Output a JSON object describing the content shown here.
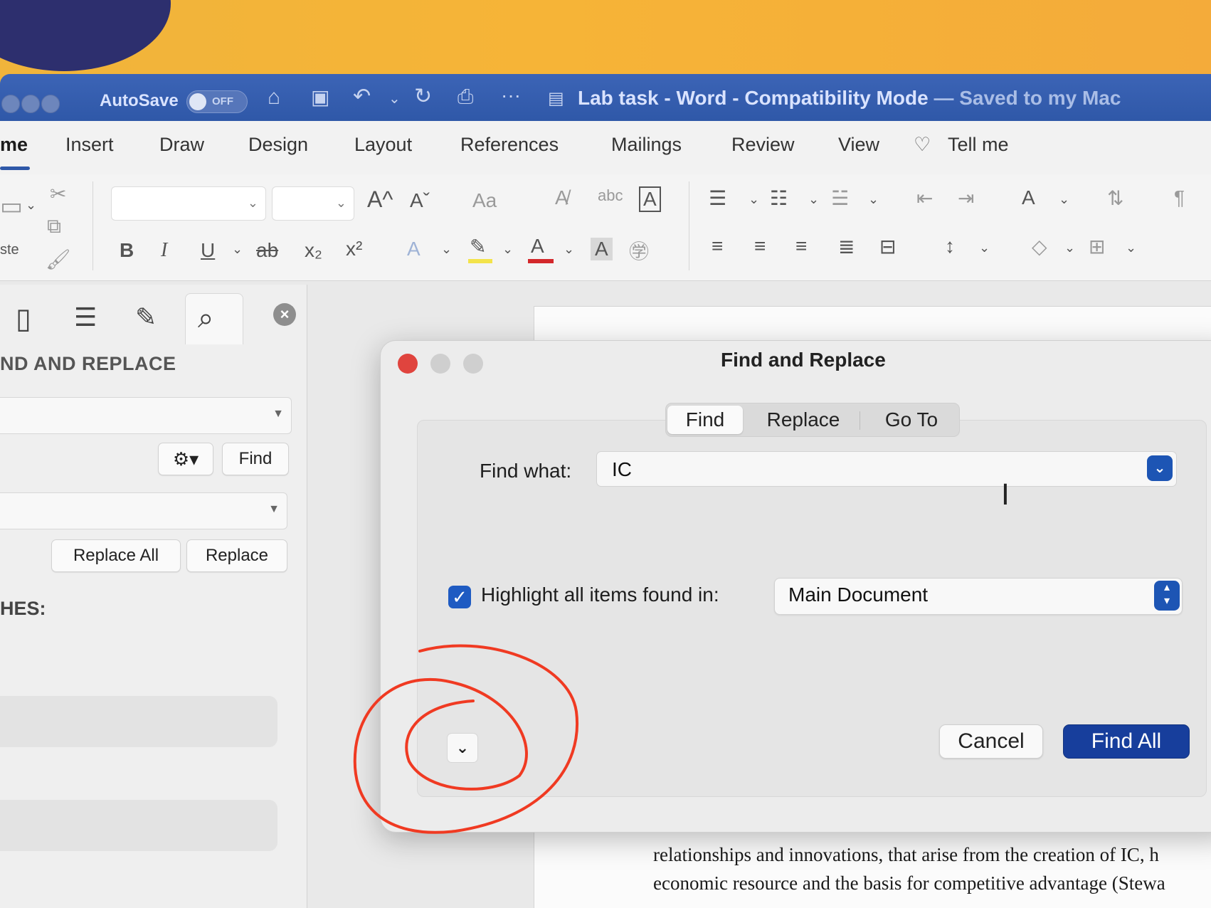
{
  "titlebar": {
    "autosave_label": "AutoSave",
    "autosave_state": "OFF",
    "doc_name": "Lab task",
    "app_name": "Word",
    "mode": "Compatibility Mode",
    "save_status": "— Saved to my Mac"
  },
  "ribbon_tabs": [
    "me",
    "Insert",
    "Draw",
    "Design",
    "Layout",
    "References",
    "Mailings",
    "Review",
    "View",
    "Tell me"
  ],
  "ribbon": {
    "paste_label": "ste",
    "bold": "B",
    "italic": "I",
    "underline": "U",
    "strikethrough": "ab",
    "subscript": "x₂",
    "superscript": "x²",
    "grow_font": "A^",
    "shrink_font": "Aˇ",
    "change_case": "Aa",
    "font_color": "A",
    "char_shading": "A",
    "pilcrow": "¶"
  },
  "nav_pane": {
    "heading": "ND AND REPLACE",
    "find_button": "Find",
    "replace_all_button": "Replace All",
    "replace_button": "Replace",
    "matches_heading": "HES:"
  },
  "dialog": {
    "title": "Find and Replace",
    "tabs": [
      "Find",
      "Replace",
      "Go To"
    ],
    "active_tab": "Find",
    "find_what_label": "Find what:",
    "find_what_value": "IC",
    "highlight_label": "Highlight all items found in:",
    "highlight_checked": true,
    "scope_value": "Main Document",
    "cancel_button": "Cancel",
    "find_all_button": "Find All"
  },
  "document": {
    "lines": [
      "relationships and innovations, that arise from the creation of IC, h",
      "economic resource and the basis for competitive advantage (Stewa"
    ]
  },
  "colors": {
    "titlebar": "#2f58a8",
    "primary_button": "#173e9c",
    "checkbox": "#1f5bc2",
    "close_dot": "#e0443e",
    "annotation": "#f03a22"
  }
}
